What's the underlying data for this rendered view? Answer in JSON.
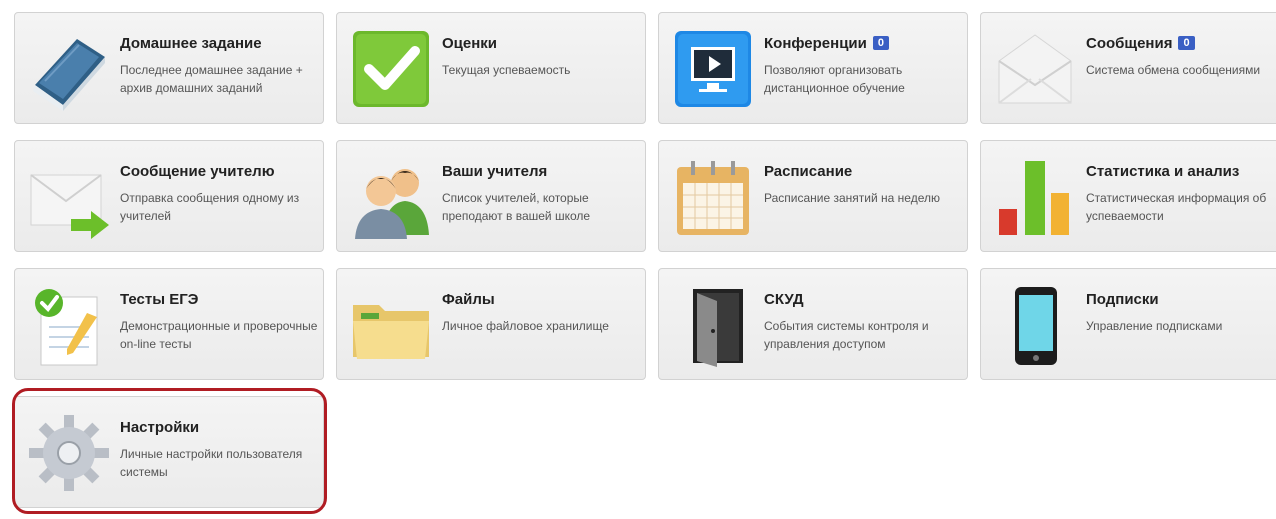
{
  "tiles": [
    {
      "title": "Домашнее задание",
      "desc": "Последнее домашнее задание + архив домашних заданий",
      "icon": "book-icon"
    },
    {
      "title": "Оценки",
      "desc": "Текущая успеваемость",
      "icon": "checkmark-icon"
    },
    {
      "title": "Конференции",
      "badge": "0",
      "desc": "Позволяют организовать дистанционное обучение",
      "icon": "monitor-play-icon"
    },
    {
      "title": "Сообщения",
      "badge": "0",
      "desc": "Система обмена сообщениями",
      "icon": "envelope-icon"
    },
    {
      "title": "Сообщение учителю",
      "desc": "Отправка сообщения одному из учителей",
      "icon": "envelope-arrow-icon"
    },
    {
      "title": "Ваши учителя",
      "desc": "Список учителей, которые преподают в вашей школе",
      "icon": "users-icon"
    },
    {
      "title": "Расписание",
      "desc": "Расписание занятий на неделю",
      "icon": "calendar-icon"
    },
    {
      "title": "Статистика и анализ",
      "desc": "Статистическая информация об успеваемости",
      "icon": "bar-chart-icon"
    },
    {
      "title": "Тесты ЕГЭ",
      "desc": "Демонстрационные и проверочные on-line тесты",
      "icon": "test-sheet-icon"
    },
    {
      "title": "Файлы",
      "desc": "Личное файловое хранилище",
      "icon": "folder-icon"
    },
    {
      "title": "СКУД",
      "desc": "События системы контроля и управления доступом",
      "icon": "door-icon"
    },
    {
      "title": "Подписки",
      "desc": "Управление подписками",
      "icon": "phone-icon"
    },
    {
      "title": "Настройки",
      "desc": "Личные настройки пользователя системы",
      "icon": "gear-icon"
    }
  ],
  "colors": {
    "highlight": "#b01c23",
    "badge": "#3a5fc4"
  }
}
